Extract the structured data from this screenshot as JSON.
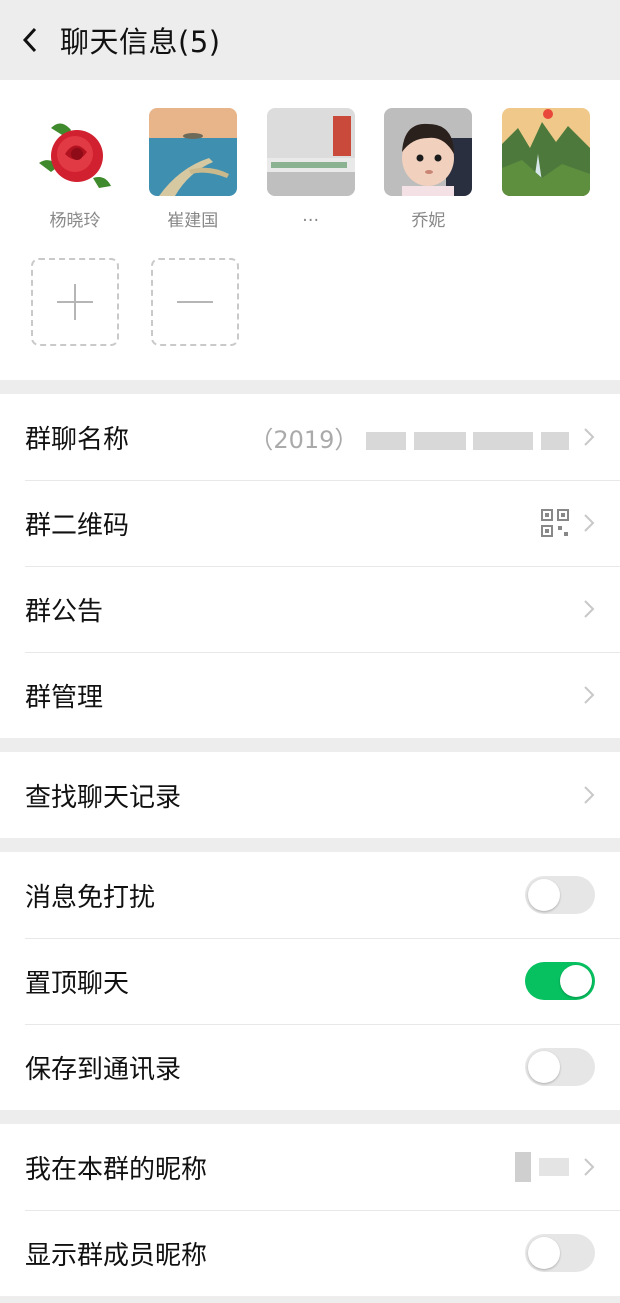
{
  "header": {
    "title": "聊天信息(5)"
  },
  "members": [
    {
      "name": "杨晓玲",
      "avatar": "rose-flower"
    },
    {
      "name": "崔建国",
      "avatar": "coastline"
    },
    {
      "name": "…",
      "avatar": "storefront-sign"
    },
    {
      "name": "乔妮",
      "avatar": "toddler-photo"
    },
    {
      "name": "",
      "avatar": "mountain-landscape"
    }
  ],
  "actions": {
    "add": "+",
    "remove": "−"
  },
  "settings": {
    "group_name": {
      "label": "群聊名称",
      "value": "（2019）"
    },
    "group_qr": {
      "label": "群二维码"
    },
    "announcement": {
      "label": "群公告"
    },
    "management": {
      "label": "群管理"
    },
    "search_history": {
      "label": "查找聊天记录"
    },
    "mute": {
      "label": "消息免打扰",
      "on": false
    },
    "sticky": {
      "label": "置顶聊天",
      "on": true
    },
    "save_contacts": {
      "label": "保存到通讯录",
      "on": false
    },
    "my_nickname": {
      "label": "我在本群的昵称",
      "value": ""
    },
    "show_nicknames": {
      "label": "显示群成员昵称",
      "on": false
    }
  },
  "colors": {
    "toggle_on": "#07c160",
    "toggle_off": "#e6e6e6",
    "background": "#ededed"
  }
}
